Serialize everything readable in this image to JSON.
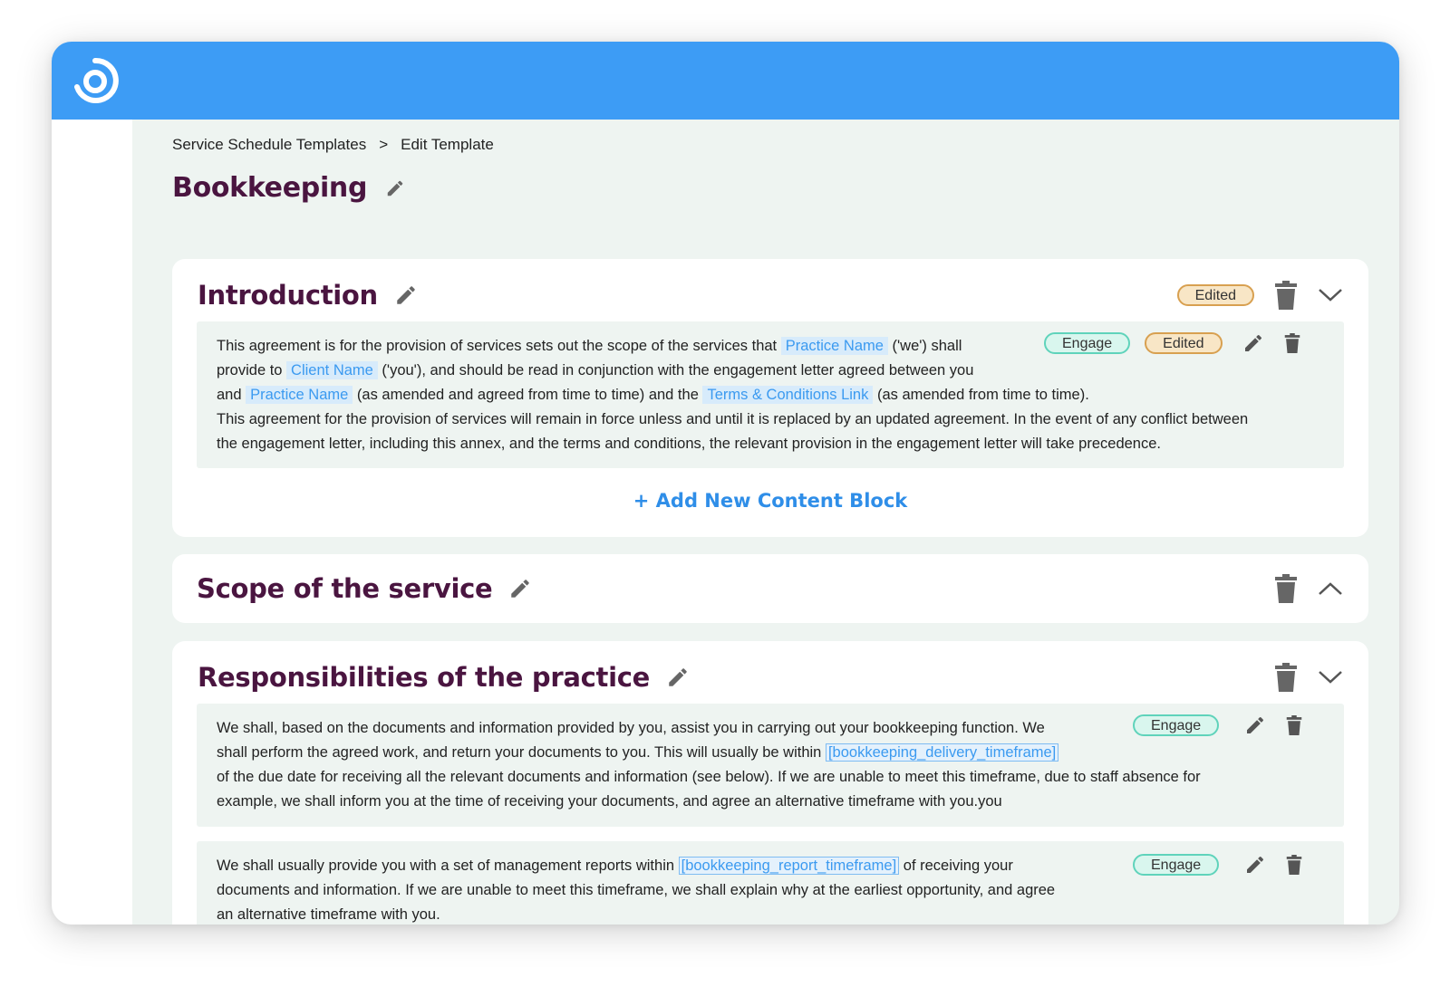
{
  "breadcrumb": {
    "items": [
      "Service Schedule Templates",
      "Edit Template"
    ],
    "separator": ">"
  },
  "page": {
    "title": "Bookkeeping"
  },
  "sections": {
    "intro": {
      "title": "Introduction",
      "badge": "Edited",
      "block": {
        "badges": [
          "Engage",
          "Edited"
        ],
        "lines": [
          [
            "This agreement is for the provision of services sets out the scope of the services that ",
            "Practice Name",
            " ('we') shall"
          ],
          [
            "provide to ",
            "Client Name",
            " ('you'), and should be read in conjunction with the engagement letter agreed between you"
          ],
          [
            "and ",
            "Practice Name",
            " (as amended and agreed from time to time) and the ",
            "Terms & Conditions Link",
            " (as amended from time to time)."
          ],
          [
            "This agreement for the provision of services will remain in force unless and until it is replaced by an updated agreement. In the event of any  conflict between"
          ],
          [
            "the engagement letter, including this annex, and the  terms and conditions, the relevant provision in the engagement letter  will take precedence."
          ]
        ]
      },
      "add_block": "+ Add New Content Block"
    },
    "scope": {
      "title": "Scope of the service"
    },
    "responsibilities": {
      "title": "Responsibilities of the practice",
      "block1": {
        "badge": "Engage",
        "line1": "We shall, based on the documents and information provided by you, assist you in carrying out your bookkeeping function. We",
        "line2_pre": "shall perform the  agreed work, and return your documents to you. This will usually be within ",
        "line2_tag": "[bookkeeping_delivery_timeframe]",
        "line3": "of the due date for receiving all the relevant documents and  information (see below). If we are unable to meet this timeframe, due to staff absence for",
        "line4": "example, we shall inform you at the time of receiving your documents, and agree an alternative timeframe with you.you"
      },
      "block2": {
        "badge": "Engage",
        "line1_pre": "We shall usually provide you with a set of management reports within ",
        "line1_tag": "[bookkeeping_report_timeframe]",
        "line1_post": " of receiving your",
        "line2": "documents and information. If we are unable to meet  this timeframe, we shall explain why at the earliest opportunity, and  agree",
        "line3": "an alternative timeframe with you."
      }
    }
  },
  "colors": {
    "topbar": "#3d9cf5",
    "heading": "#4a1540",
    "link": "#2f8ee8",
    "edited": "#d8a050",
    "engage": "#5fd3bb"
  },
  "icons": [
    "logo-icon",
    "pencil-icon",
    "trash-icon",
    "chevron-down-icon",
    "chevron-up-icon"
  ]
}
